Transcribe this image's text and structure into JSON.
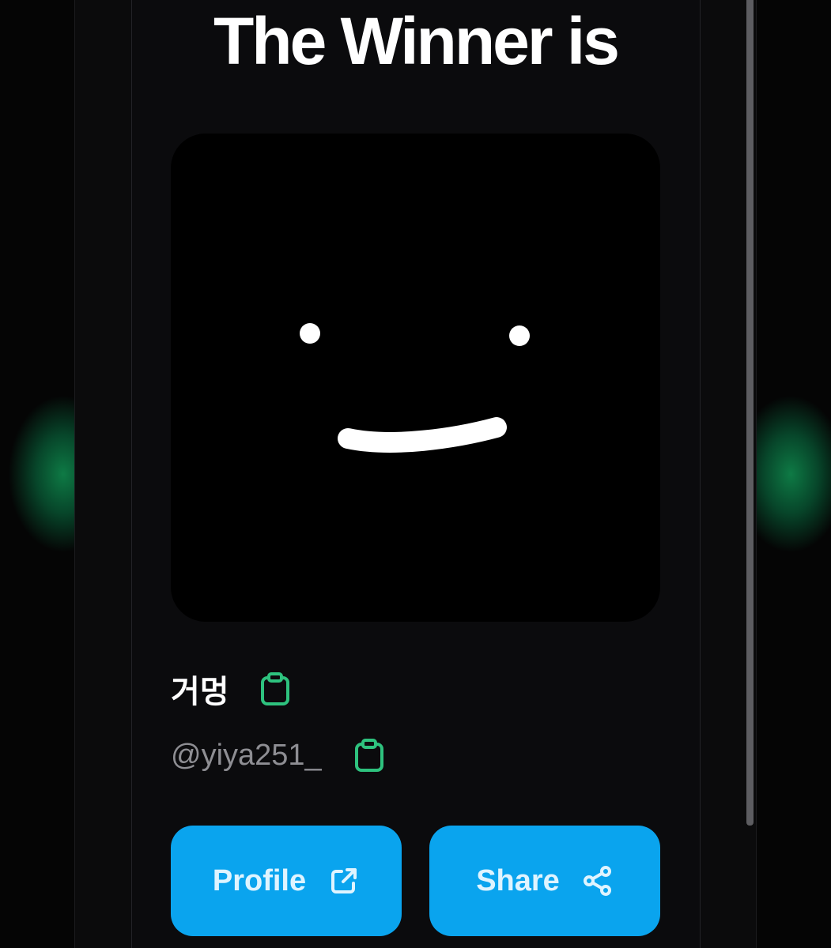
{
  "header": {
    "title": "The Winner is"
  },
  "winner": {
    "name": "거멍",
    "handle": "@yiya251_",
    "avatar_icon": "smiley-face-avatar",
    "copy_icon": "clipboard-icon"
  },
  "actions": {
    "profile_label": "Profile",
    "profile_icon": "external-link-icon",
    "share_label": "Share",
    "share_icon": "share-icon"
  },
  "colors": {
    "accent_button": "#0aa4ee",
    "copy_icon": "#2ec27e",
    "background": "#0b0b0d",
    "glow": "#0e7a45"
  }
}
